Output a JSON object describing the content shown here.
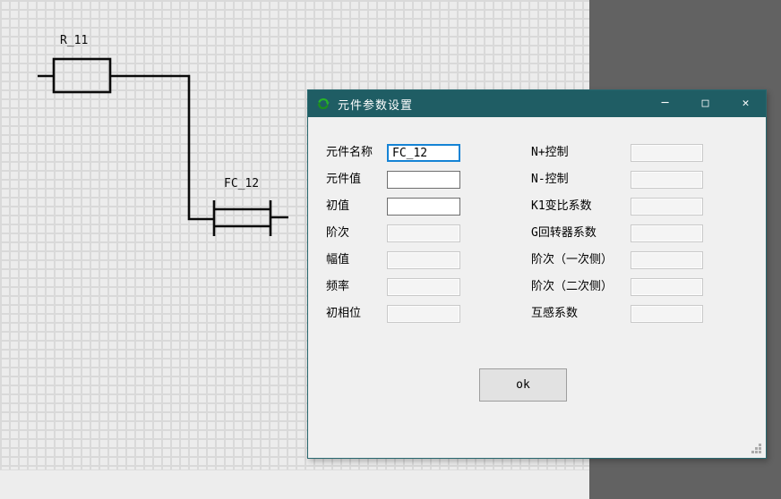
{
  "window": {
    "title": "元件参数设置",
    "controls": {
      "minimize": "─",
      "maximize": "□",
      "close": "✕"
    }
  },
  "canvas": {
    "components": [
      {
        "id": "R_11",
        "label": "R_11",
        "type": "resistor"
      },
      {
        "id": "FC_12",
        "label": "FC_12",
        "type": "coupled-element"
      }
    ]
  },
  "dialog": {
    "icon": "sync-icon",
    "fields_left": [
      {
        "label": "元件名称",
        "value": "FC_12",
        "state": "focused"
      },
      {
        "label": "元件值",
        "value": "",
        "state": "enabled"
      },
      {
        "label": "初值",
        "value": "",
        "state": "enabled"
      },
      {
        "label": "阶次",
        "value": "",
        "state": "disabled"
      },
      {
        "label": "幅值",
        "value": "",
        "state": "disabled"
      },
      {
        "label": "频率",
        "value": "",
        "state": "disabled"
      },
      {
        "label": "初相位",
        "value": "",
        "state": "disabled"
      }
    ],
    "fields_right": [
      {
        "label": "N+控制",
        "value": "",
        "state": "disabled"
      },
      {
        "label": "N-控制",
        "value": "",
        "state": "disabled"
      },
      {
        "label": "K1变比系数",
        "value": "",
        "state": "disabled"
      },
      {
        "label": "G回转器系数",
        "value": "",
        "state": "disabled"
      },
      {
        "label": "阶次（一次侧）",
        "value": "",
        "state": "disabled"
      },
      {
        "label": "阶次（二次侧）",
        "value": "",
        "state": "disabled"
      },
      {
        "label": "互感系数",
        "value": "",
        "state": "disabled"
      }
    ],
    "ok_label": "ok"
  },
  "colors": {
    "titlebar": "#1f5d64",
    "icon_green": "#28b428",
    "focus_blue": "#1583d5",
    "canvas_cell": "#ececec",
    "canvas_line": "#d9d9d9",
    "side_panel": "#626262"
  }
}
